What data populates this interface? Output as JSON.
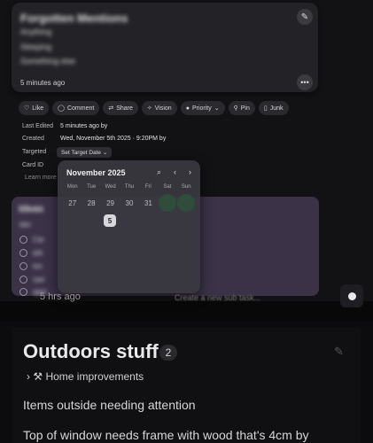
{
  "note_card": {
    "title": "Forgotten Mentions",
    "line1": "Anything",
    "line2": "Sleeping",
    "line3": "Something else",
    "time": "5 minutes ago"
  },
  "actions": [
    {
      "label": "Like",
      "icon": "heart-icon"
    },
    {
      "label": "Comment",
      "icon": "comment-icon"
    },
    {
      "label": "Share",
      "icon": "share-icon"
    },
    {
      "label": "Vision",
      "icon": "sparkle-icon"
    },
    {
      "label": "Priority",
      "icon": "circle-icon"
    },
    {
      "label": "Pin",
      "icon": "pin-icon"
    },
    {
      "label": "Junk",
      "icon": "trash-icon"
    }
  ],
  "meta": {
    "last_edited_label": "Last Edited",
    "last_edited_value": "5 minutes ago by",
    "created_label": "Created",
    "created_value": "Wed, November 5th 2025 · 9:20PM by",
    "targeted_label": "Targeted",
    "targeted_button": "Set Target Date",
    "card_id_label": "Card ID",
    "learn_more": "Learn more"
  },
  "calendar": {
    "month": "November",
    "year": "2025",
    "weekdays": [
      "Mon",
      "Tue",
      "Wed",
      "Thu",
      "Fri",
      "Sat",
      "Sun"
    ],
    "first_row": [
      "27",
      "28",
      "29",
      "30",
      "31",
      "",
      ""
    ],
    "selected_day": "5"
  },
  "purple_card": {
    "title": "Ideas",
    "subtitle": "dev",
    "items": [
      "Car",
      "ark",
      "ion",
      "ryer",
      "aper"
    ]
  },
  "under_card": {
    "time": "5 hrs ago",
    "preview": "Create a new sub task..."
  },
  "outdoors": {
    "title": "Outdoors stuff",
    "count": "2",
    "breadcrumb": "Home improvements",
    "description": "Items outside needing attention",
    "line2": "Top of window needs frame with wood that's 4cm by"
  }
}
